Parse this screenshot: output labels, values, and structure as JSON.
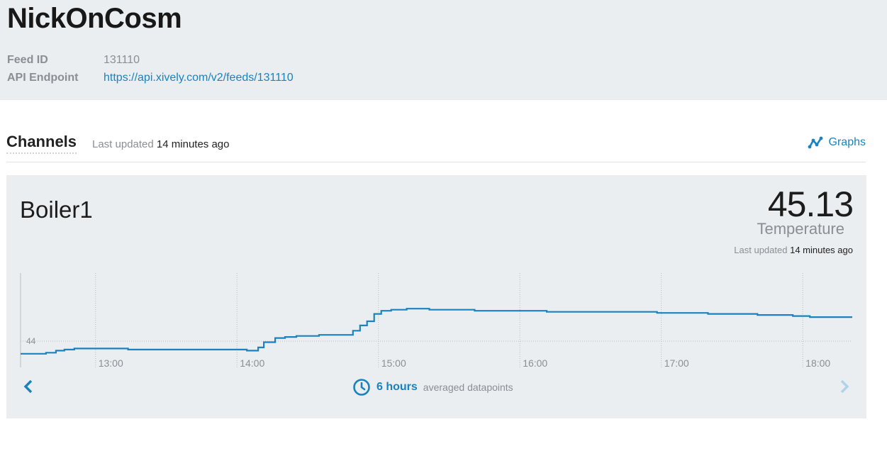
{
  "feed": {
    "title": "NickOnCosm",
    "id_label": "Feed ID",
    "id_value": "131110",
    "endpoint_label": "API Endpoint",
    "endpoint_value": "https://api.xively.com/v2/feeds/131110"
  },
  "channels": {
    "title": "Channels",
    "updated_prefix": "Last updated",
    "updated_value": "14 minutes ago",
    "graphs_label": "Graphs",
    "graphs_icon": "graph-line-icon"
  },
  "channel": {
    "name": "Boiler1",
    "value": "45.13",
    "unit": "Temperature",
    "updated_prefix": "Last updated",
    "updated_value": "14 minutes ago",
    "duration_value": "6 hours",
    "duration_desc": "averaged datapoints",
    "duration_icon": "clock-icon",
    "prev_icon": "chevron-left-icon",
    "next_icon": "chevron-right-icon",
    "accent_color": "#1a82be"
  },
  "chart_data": {
    "type": "line",
    "step": true,
    "color": "#1a82be",
    "xlabel": "",
    "ylabel": "",
    "y_ticks": [
      44
    ],
    "x_ticks": [
      "13:00",
      "14:00",
      "15:00",
      "16:00",
      "17:00",
      "18:00"
    ],
    "x_tick_hours": [
      13,
      14,
      15,
      16,
      17,
      18
    ],
    "xlim": [
      12.47,
      18.35
    ],
    "ylim": [
      43.75,
      44.65
    ],
    "grid": true,
    "series": [
      {
        "x": [
          12.47,
          12.65,
          12.72,
          12.78,
          12.85,
          13.23,
          14.07,
          14.15,
          14.19,
          14.27,
          14.34,
          14.42,
          14.58,
          14.82,
          14.87,
          14.92,
          14.97,
          15.02,
          15.09,
          15.2,
          15.36,
          15.68,
          16.19,
          16.52,
          16.97,
          17.33,
          17.68,
          17.93,
          18.05,
          18.35
        ],
        "y": [
          43.88,
          43.89,
          43.91,
          43.92,
          43.93,
          43.92,
          43.91,
          43.94,
          43.99,
          44.03,
          44.04,
          44.05,
          44.06,
          44.1,
          44.15,
          44.19,
          44.26,
          44.29,
          44.3,
          44.31,
          44.3,
          44.29,
          44.28,
          44.28,
          44.27,
          44.26,
          44.25,
          44.24,
          44.23,
          44.23
        ]
      }
    ]
  }
}
